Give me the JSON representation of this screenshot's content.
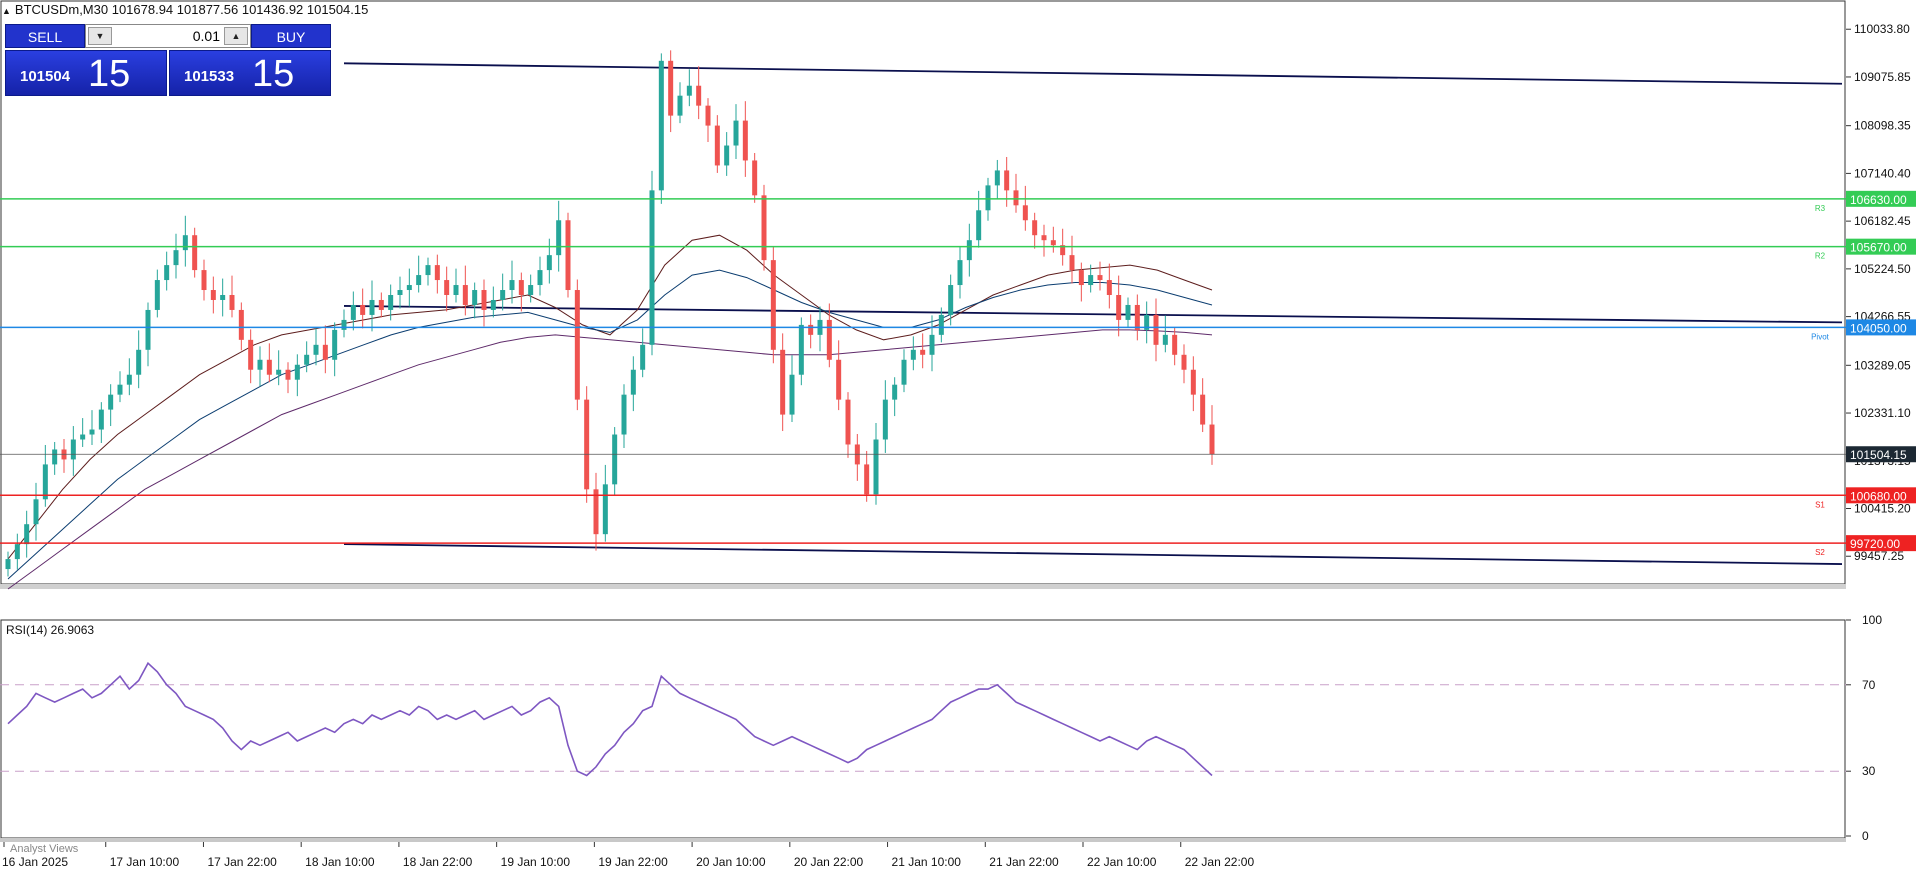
{
  "header": {
    "symbol_line": "BTCUSDm,M30   101678.94 101877.56 101436.92 101504.15"
  },
  "trade_panel": {
    "sell_label": "SELL",
    "buy_label": "BUY",
    "lot_value": "0.01",
    "bid_big": "101504",
    "bid_pips": "15",
    "ask_big": "101533",
    "ask_pips": "15"
  },
  "footer": {
    "analyst_views": "Analyst Views"
  },
  "colors": {
    "bull": "#26a69a",
    "bear": "#ef5350",
    "resistance": "#33cc55",
    "support": "#ee2222",
    "pivot": "#1e88e5",
    "channel": "#0a0f4d",
    "rsi": "#7e57c2",
    "price_label_bg": "#1c2833"
  },
  "chart_data": [
    {
      "type": "candlestick",
      "symbol": "BTCUSDm",
      "timeframe": "M30",
      "ylim": [
        98900,
        110500
      ],
      "y_ticks": [
        110033.8,
        109075.85,
        108098.35,
        107140.4,
        106182.45,
        105224.5,
        104266.55,
        103289.05,
        102331.1,
        101373.15,
        100415.2,
        99457.25
      ],
      "x_ticks": [
        "16 Jan 2025",
        "17 Jan 10:00",
        "17 Jan 22:00",
        "18 Jan 10:00",
        "18 Jan 22:00",
        "19 Jan 10:00",
        "19 Jan 22:00",
        "20 Jan 10:00",
        "20 Jan 22:00",
        "21 Jan 10:00",
        "21 Jan 22:00",
        "22 Jan 10:00",
        "22 Jan 22:00"
      ],
      "last_price": 101504.15,
      "levels": [
        {
          "name": "R3",
          "value": 106630.0,
          "label": "106630.00",
          "kind": "resistance"
        },
        {
          "name": "R2",
          "value": 105670.0,
          "label": "105670.00",
          "kind": "resistance"
        },
        {
          "name": "Pivot",
          "value": 104050.0,
          "label": "104050.00",
          "kind": "pivot"
        },
        {
          "name": "S1",
          "value": 100680.0,
          "label": "100680.00",
          "kind": "support"
        },
        {
          "name": "S2",
          "value": 99720.0,
          "label": "99720.00",
          "kind": "support"
        }
      ],
      "level_tags": {
        "R3": "R3",
        "R2": "R2",
        "Pivot": "Pivot",
        "S1": "S1",
        "S2": "S2"
      },
      "channel": [
        {
          "x": [
            "18 Jan 22:00",
            "end"
          ],
          "y": [
            109350,
            108940
          ]
        },
        {
          "x": [
            "18 Jan 22:00",
            "end"
          ],
          "y": [
            104480,
            104150
          ]
        },
        {
          "x": [
            "18 Jan 22:00",
            "end"
          ],
          "y": [
            99700,
            99300
          ]
        }
      ],
      "series_close": [
        99400,
        99700,
        100100,
        100600,
        101300,
        101600,
        101400,
        101800,
        101900,
        102000,
        102400,
        102700,
        102900,
        103100,
        103600,
        104400,
        105000,
        105300,
        105600,
        105900,
        105200,
        104800,
        104600,
        104700,
        104400,
        103800,
        103200,
        103400,
        103100,
        103200,
        103000,
        103300,
        103500,
        103700,
        103400,
        104000,
        104200,
        104500,
        104300,
        104600,
        104400,
        104700,
        104800,
        104900,
        105100,
        105300,
        105000,
        104700,
        104900,
        104500,
        104800,
        104400,
        104600,
        104800,
        105000,
        104700,
        104900,
        105200,
        105500,
        106200,
        104800,
        102600,
        100800,
        99900,
        100900,
        101900,
        102700,
        103200,
        103700,
        106800,
        109400,
        108300,
        108700,
        108900,
        108500,
        108100,
        107300,
        107700,
        108200,
        107400,
        106700,
        105400,
        103600,
        102300,
        103100,
        104100,
        103900,
        104200,
        103400,
        102600,
        101700,
        101300,
        100700,
        101800,
        102600,
        102900,
        103400,
        103600,
        103500,
        103900,
        104300,
        104900,
        105400,
        105800,
        106400,
        106900,
        107200,
        106800,
        106500,
        106200,
        105900,
        105800,
        105700,
        105500,
        105200,
        104900,
        105100,
        105000,
        104700,
        104200,
        104500,
        104000,
        104300,
        103700,
        103900,
        103500,
        103200,
        102700,
        102100,
        101500
      ],
      "moving_averages": [
        {
          "period": 50,
          "color": "#5d1d1d",
          "values": [
            99400,
            100100,
            100800,
            101400,
            101900,
            102300,
            102700,
            103100,
            103400,
            103700,
            103900,
            104000,
            104100,
            104200,
            104300,
            104350,
            104400,
            104500,
            104600,
            104700,
            104450,
            104100,
            103900,
            104400,
            105300,
            105800,
            105900,
            105600,
            105100,
            104700,
            104300,
            104000,
            103800,
            103900,
            104100,
            104400,
            104700,
            104900,
            105100,
            105200,
            105250,
            105300,
            105200,
            105000,
            104800
          ]
        },
        {
          "period": 100,
          "color": "#0b3d70",
          "values": [
            99000,
            99500,
            100000,
            100500,
            101000,
            101400,
            101800,
            102200,
            102500,
            102800,
            103100,
            103300,
            103500,
            103700,
            103900,
            104050,
            104150,
            104250,
            104300,
            104350,
            104200,
            104050,
            103950,
            104200,
            104700,
            105100,
            105200,
            105050,
            104800,
            104550,
            104350,
            104200,
            104050,
            104050,
            104200,
            104450,
            104650,
            104800,
            104900,
            104950,
            104950,
            104900,
            104800,
            104650,
            104500
          ]
        },
        {
          "period": 200,
          "color": "#5e2a6a",
          "values": [
            98800,
            99200,
            99600,
            100000,
            100400,
            100800,
            101100,
            101400,
            101700,
            102000,
            102300,
            102500,
            102700,
            102900,
            103100,
            103300,
            103450,
            103600,
            103750,
            103850,
            103900,
            103850,
            103800,
            103750,
            103700,
            103650,
            103600,
            103550,
            103500,
            103500,
            103500,
            103550,
            103600,
            103650,
            103700,
            103750,
            103800,
            103850,
            103900,
            103950,
            104000,
            104000,
            103980,
            103950,
            103900
          ]
        }
      ]
    },
    {
      "type": "line",
      "indicator": "RSI(14)",
      "title": "RSI(14) 26.9063",
      "ylim": [
        0,
        100
      ],
      "y_ticks": [
        100,
        70,
        30,
        0
      ],
      "levels": [
        70,
        30
      ],
      "series": [
        {
          "values": [
            52,
            56,
            60,
            66,
            64,
            62,
            64,
            66,
            68,
            64,
            66,
            70,
            74,
            68,
            72,
            80,
            76,
            70,
            66,
            60,
            58,
            56,
            54,
            50,
            44,
            40,
            44,
            42,
            44,
            46,
            48,
            44,
            46,
            48,
            50,
            48,
            52,
            54,
            52,
            56,
            54,
            56,
            58,
            56,
            60,
            58,
            54,
            56,
            54,
            56,
            58,
            54,
            56,
            58,
            60,
            56,
            58,
            62,
            64,
            60,
            42,
            30,
            28,
            32,
            38,
            42,
            48,
            52,
            58,
            60,
            74,
            70,
            66,
            64,
            62,
            60,
            58,
            56,
            54,
            50,
            46,
            44,
            42,
            44,
            46,
            44,
            42,
            40,
            38,
            36,
            34,
            36,
            40,
            42,
            44,
            46,
            48,
            50,
            52,
            54,
            58,
            62,
            64,
            66,
            68,
            68,
            70,
            66,
            62,
            60,
            58,
            56,
            54,
            52,
            50,
            48,
            46,
            44,
            46,
            44,
            42,
            40,
            44,
            46,
            44,
            42,
            40,
            36,
            32,
            28
          ]
        }
      ]
    }
  ]
}
